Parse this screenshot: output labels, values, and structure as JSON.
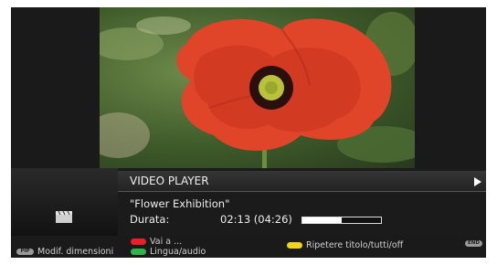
{
  "player": {
    "title": "VIDEO PLAYER",
    "file_name": "\"Flower Exhibition\"",
    "duration_label": "Durata:",
    "duration_value": "02:13 (04:26)",
    "progress": 0.5
  },
  "help": {
    "pip_key": "PIP",
    "pip_text": "Modif. dimensioni",
    "red_text": "Vai a ...",
    "green_text": "Lingua/audio",
    "yellow_text": "Ripetere titolo/tutti/off",
    "end_key": "END"
  },
  "icons": {
    "play": "play-icon",
    "clapper": "clapperboard-icon"
  },
  "colors": {
    "red": "#e8202a",
    "green": "#2fb34a",
    "yellow": "#f2d21c",
    "key_grey": "#9a9a9a"
  }
}
